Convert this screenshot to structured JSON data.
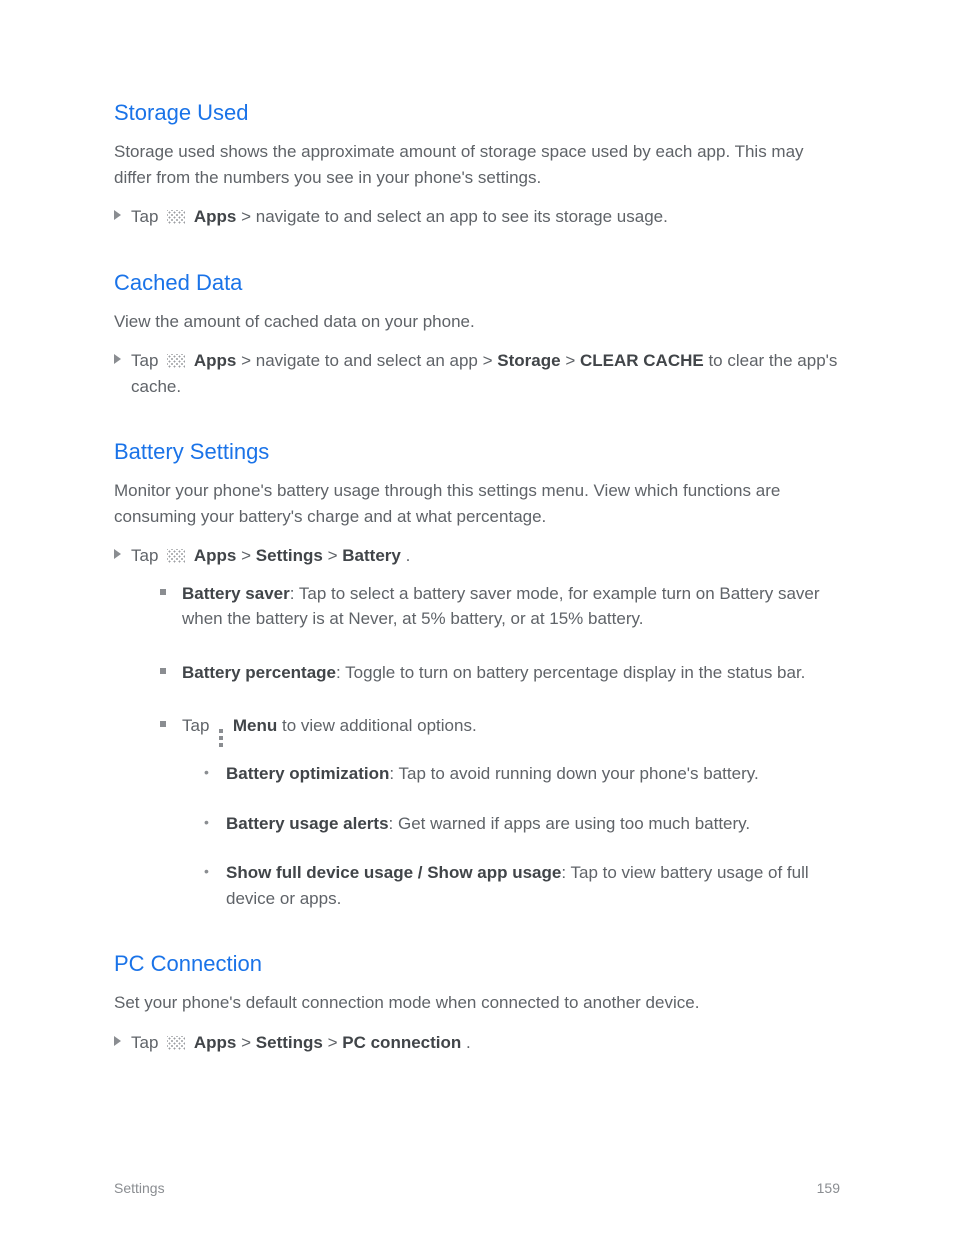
{
  "sections": {
    "storage_used": {
      "title": "Storage Used",
      "text": "Storage used shows the approximate amount of storage space used by each app. This may differ from the numbers you see in your phone's settings.",
      "step_prefix": "Tap",
      "step_bold": "Apps",
      "step_suffix": "> navigate to and select an app to see its storage usage."
    },
    "cached": {
      "title": "Cached Data",
      "text": "View the amount of cached data on your phone.",
      "step_prefix": "Tap",
      "step_bold": "Apps",
      "step_cont": "> navigate to and select an app >",
      "step_bold2": "Storage",
      "step_end": ">",
      "step_bold3": "CLEAR CACHE",
      "step_end2": "to clear the app's cache."
    },
    "battery": {
      "title": "Battery Settings",
      "intro": "Monitor your phone's battery usage through this settings menu. View which functions are consuming your battery's charge and at what percentage.",
      "step_prefix": "Tap",
      "step_bold": "Apps",
      "step_cont": ">",
      "step_bold2": "Settings",
      "step_cont2": ">",
      "step_bold3": "Battery",
      "step_end": "."
    },
    "battery_items": {
      "bsaver": {
        "bold": "Battery saver",
        "text": ": Tap to select a battery saver mode, for example turn on Battery saver when the battery is at Never, at 5% battery, or at 15% battery."
      },
      "bpct": {
        "bold": "Battery percentage",
        "text": ": Toggle to turn on battery percentage display in the status bar."
      },
      "menu": {
        "prefix": "Tap",
        "bold": "Menu",
        "text": " to view additional options."
      },
      "sub1": {
        "bold": "Battery optimization",
        "text": ": Tap to avoid running down your phone's battery."
      },
      "sub2": {
        "bold": "Battery usage alerts",
        "text": ": Get warned if apps are using too much battery."
      },
      "sub3": {
        "bold": "Show full device usage / Show app usage",
        "text": ": Tap to view battery usage of full device or apps."
      }
    },
    "pc": {
      "title": "PC Connection",
      "intro": "Set your phone's default connection mode when connected to another device.",
      "step_prefix": "Tap",
      "step_bold": "Apps",
      "step_cont": ">",
      "step_bold2": "Settings",
      "step_cont2": ">",
      "step_bold3": "PC connection",
      "step_end": "."
    }
  },
  "footer": {
    "left": "Settings",
    "right": "159"
  }
}
